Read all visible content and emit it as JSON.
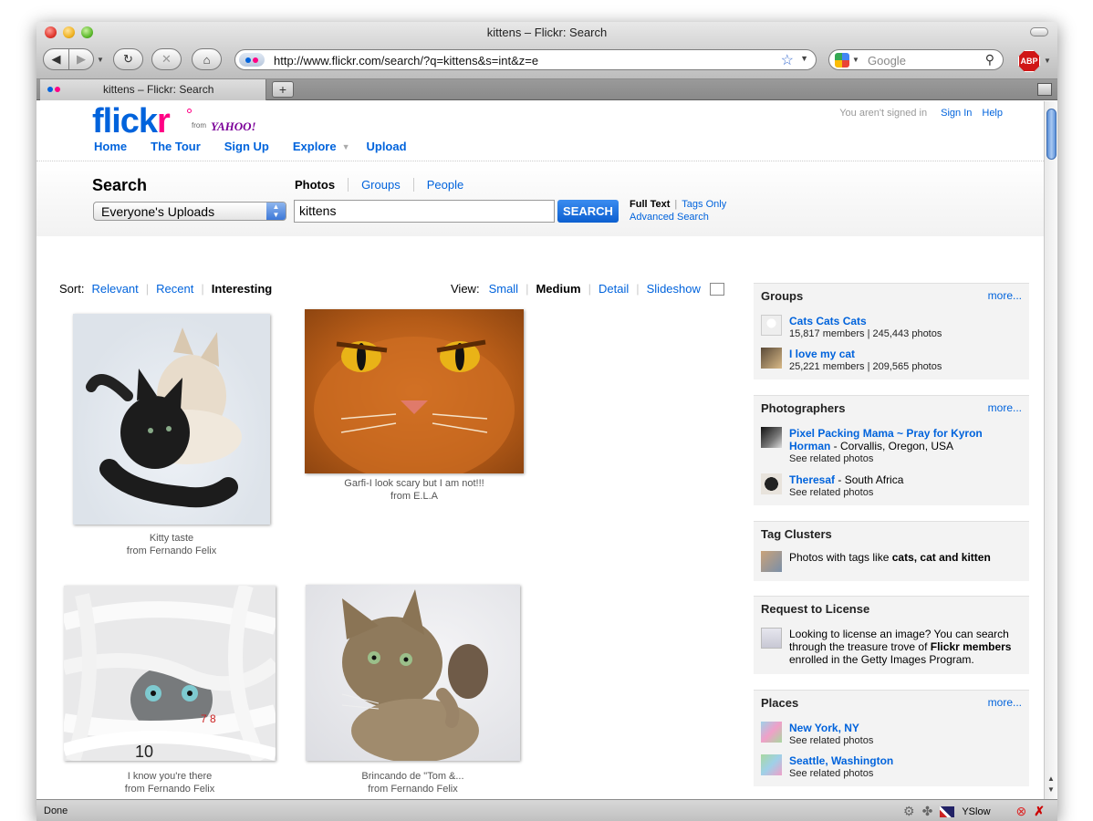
{
  "window": {
    "title": "kittens – Flickr: Search"
  },
  "toolbar": {
    "url": "http://www.flickr.com/search/?q=kittens&s=int&z=e",
    "search_placeholder": "Google",
    "abp_label": "ABP"
  },
  "tab": {
    "label": "kittens – Flickr: Search",
    "new_tab": "+"
  },
  "header": {
    "logo_a": "flick",
    "logo_b": "r",
    "from": "from",
    "yahoo": "YAHOO!",
    "nav": [
      "Home",
      "The Tour",
      "Sign Up",
      "Explore",
      "Upload"
    ],
    "signed_out": "You aren't signed in",
    "sign_in": "Sign In",
    "help": "Help"
  },
  "search": {
    "title": "Search",
    "scope": "Everyone's Uploads",
    "tabs": [
      "Photos",
      "Groups",
      "People"
    ],
    "query": "kittens",
    "button": "SEARCH",
    "full_text": "Full Text",
    "tags_only": "Tags Only",
    "advanced": "Advanced Search"
  },
  "results": {
    "sort_label": "Sort:",
    "sort": [
      "Relevant",
      "Recent",
      "Interesting"
    ],
    "view_label": "View:",
    "view": [
      "Small",
      "Medium",
      "Detail",
      "Slideshow"
    ],
    "photos": [
      {
        "title": "Kitty taste",
        "by": "from Fernando Felix"
      },
      {
        "title": "Garfi-I look scary but I am not!!!",
        "by": "from E.L.A"
      },
      {
        "title": "I know you're there",
        "by": "from Fernando Felix"
      },
      {
        "title": "Brincando de \"Tom &...",
        "by": "from Fernando Felix"
      }
    ]
  },
  "sidebar": {
    "more": "more...",
    "groups": {
      "title": "Groups",
      "items": [
        {
          "name": "Cats Cats Cats",
          "stats": "15,817 members | 245,443 photos"
        },
        {
          "name": "I love my cat",
          "stats": "25,221 members | 209,565 photos"
        }
      ]
    },
    "photographers": {
      "title": "Photographers",
      "items": [
        {
          "name_a": "Pixel Packing Mama ~ Pray for Kyron",
          "name_b": "Horman",
          "loc": " - Corvallis, Oregon, USA",
          "related": "See related photos"
        },
        {
          "name_a": "Theresaf",
          "loc": " - South Africa",
          "related": "See related photos"
        }
      ]
    },
    "tags": {
      "title": "Tag Clusters",
      "prefix": "Photos with tags like ",
      "tags": "cats, cat and kitten"
    },
    "license": {
      "title": "Request to License",
      "line1": "Looking to license an image? You can search",
      "line2a": "through the treasure trove of ",
      "line2b": "Flickr members",
      "line3": "enrolled in the Getty Images Program."
    },
    "places": {
      "title": "Places",
      "items": [
        {
          "name": "New York, NY",
          "related": "See related photos"
        },
        {
          "name": "Seattle, Washington",
          "related": "See related photos"
        }
      ]
    }
  },
  "status": {
    "text": "Done",
    "yslow": "YSlow"
  },
  "colors": {
    "flickr_blue": "#0063dc",
    "flickr_pink": "#ff0084"
  }
}
